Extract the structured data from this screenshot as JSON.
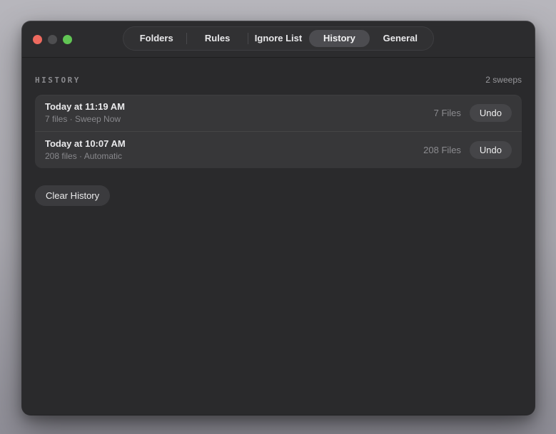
{
  "window": {
    "tabs": [
      {
        "label": "Folders",
        "active": false
      },
      {
        "label": "Rules",
        "active": false
      },
      {
        "label": "Ignore List",
        "active": false
      },
      {
        "label": "History",
        "active": true
      },
      {
        "label": "General",
        "active": false
      }
    ],
    "traffic_lights": [
      "close",
      "minimize",
      "zoom"
    ]
  },
  "history": {
    "section_label": "HISTORY",
    "sweep_count": "2 sweeps",
    "rows": [
      {
        "title": "Today at 11:19 AM",
        "subtitle": "7 files · Sweep Now",
        "files_label": "7 Files",
        "undo_label": "Undo"
      },
      {
        "title": "Today at 10:07 AM",
        "subtitle": "208 files · Automatic",
        "files_label": "208 Files",
        "undo_label": "Undo"
      }
    ],
    "clear_button_label": "Clear History"
  },
  "colors": {
    "desktop_top": "#b7b6bc",
    "desktop_bottom": "#8f8e97",
    "window_bg": "#2a2a2c",
    "titlebar_bg": "#2c2c2e",
    "tabbar_bg": "#313133",
    "selected_tab_bg": "#4c4c50",
    "list_bg": "#373739",
    "button_bg": "#454548",
    "traffic_red": "#ee6a5f",
    "traffic_gray": "#4e4e50",
    "traffic_green": "#61c554"
  }
}
